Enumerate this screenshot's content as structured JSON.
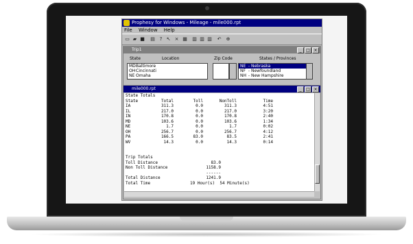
{
  "app": {
    "title": "Prophesy for Windows - Mileage - mile000.rpt",
    "menu": [
      "File",
      "Window",
      "Help"
    ]
  },
  "toolbar_icons": [
    "new-icon",
    "open-icon",
    "save-icon",
    "print-icon",
    "help-icon",
    "pointer-help-icon",
    "close-icon",
    "grid-icon",
    "tile-icon",
    "cascade-icon",
    "arrange-icon",
    "route-icon",
    "map-icon"
  ],
  "trip_window": {
    "title": "Trip1",
    "headers": {
      "state": "State",
      "location": "Location",
      "zip": "Zip Code",
      "states_provinces": "States / Provinces"
    },
    "stops": [
      {
        "state": "MD",
        "location": "Baltimore"
      },
      {
        "state": "OH",
        "location": "Cincinnati"
      },
      {
        "state": "NE",
        "location": "Omaha"
      }
    ],
    "provinces": [
      {
        "code": "NE",
        "name": "Nebraska",
        "selected": true
      },
      {
        "code": "NF",
        "name": "Newfoundland",
        "selected": false
      },
      {
        "code": "NH",
        "name": "New Hampshire",
        "selected": false
      }
    ]
  },
  "report_window": {
    "title": "mile000.rpt",
    "section_title": "State Totals",
    "columns": [
      "State",
      "Total",
      "Toll",
      "NonToll",
      "Time"
    ],
    "rows": [
      {
        "state": "IA",
        "total": "311.3",
        "toll": "0.0",
        "nontoll": "311.3",
        "time": "4:51"
      },
      {
        "state": "IL",
        "total": "217.0",
        "toll": "0.0",
        "nontoll": "217.0",
        "time": "3:20"
      },
      {
        "state": "IN",
        "total": "170.8",
        "toll": "0.0",
        "nontoll": "170.8",
        "time": "2:40"
      },
      {
        "state": "MD",
        "total": "103.6",
        "toll": "0.0",
        "nontoll": "103.6",
        "time": "1:34"
      },
      {
        "state": "NE",
        "total": "1.7",
        "toll": "0.0",
        "nontoll": "1.7",
        "time": "0:02"
      },
      {
        "state": "OH",
        "total": "256.7",
        "toll": "0.0",
        "nontoll": "256.7",
        "time": "4:12"
      },
      {
        "state": "PA",
        "total": "166.5",
        "toll": "83.0",
        "nontoll": "83.5",
        "time": "2:41"
      },
      {
        "state": "WV",
        "total": "14.3",
        "toll": "0.0",
        "nontoll": "14.3",
        "time": "0:14"
      }
    ],
    "trip_totals_title": "Trip Totals",
    "toll_distance_label": "Toll Distance",
    "toll_distance": "83.0",
    "non_toll_distance_label": "Non Toll Distance",
    "non_toll_distance": "1158.9",
    "separator": "------",
    "total_distance_label": "Total Distance",
    "total_distance": "1241.9",
    "total_time_label": "Total Time",
    "total_time": "19 Hour(s)  54 Minute(s)"
  },
  "window_buttons": {
    "minimize": "_",
    "maximize": "□",
    "close": "×"
  },
  "colors": {
    "title_active": "#000080",
    "title_inactive": "#808080",
    "face": "#c0c0c0"
  }
}
